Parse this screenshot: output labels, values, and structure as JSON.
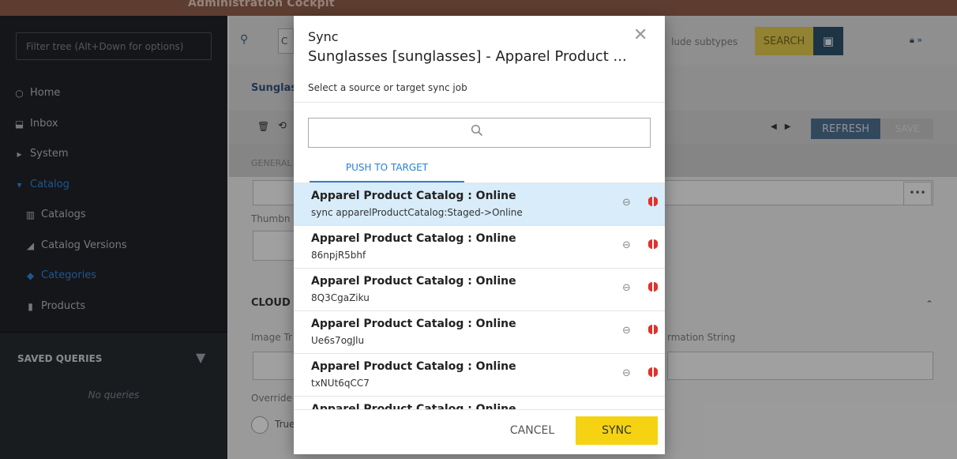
{
  "app": {
    "title": "Administration Cockpit"
  },
  "sidebar": {
    "filter_placeholder": "Filter tree (Alt+Down for options)",
    "items": [
      {
        "label": "Home",
        "icon": "home-icon"
      },
      {
        "label": "Inbox",
        "icon": "inbox-icon"
      },
      {
        "label": "System",
        "icon": "caret-right-icon"
      },
      {
        "label": "Catalog",
        "icon": "caret-down-icon"
      },
      {
        "label": "Catalogs",
        "icon": "catalogs-icon"
      },
      {
        "label": "Catalog Versions",
        "icon": "catalog-versions-icon"
      },
      {
        "label": "Categories",
        "icon": "tag-icon"
      },
      {
        "label": "Products",
        "icon": "product-icon"
      }
    ],
    "saved_queries": {
      "title": "SAVED QUERIES",
      "empty": "No queries"
    }
  },
  "toolbar": {
    "subtypes_label": "lude subtypes",
    "search_label": "SEARCH",
    "query_prefix": "C"
  },
  "editor": {
    "title": "Sunglas",
    "refresh_label": "REFRESH",
    "save_label": "SAVE",
    "general_tab": "GENERAL",
    "thumbnail_label": "Thumbn",
    "cloud_section": "CLOUD",
    "image_tr_label": "Image Tr",
    "transformation_label": "rmation String",
    "override_label": "Override",
    "true_label": "True"
  },
  "modal": {
    "title": "Sync",
    "subtitle": "Sunglasses [sunglasses] - Apparel Product ...",
    "description": "Select a source or target sync job",
    "tab_label": "PUSH TO TARGET",
    "rows": [
      {
        "title": "Apparel Product Catalog : Online",
        "detail": "sync apparelProductCatalog:Staged->Online"
      },
      {
        "title": "Apparel Product Catalog : Online",
        "detail": "86npjR5bhf"
      },
      {
        "title": "Apparel Product Catalog : Online",
        "detail": "8Q3CgaZiku"
      },
      {
        "title": "Apparel Product Catalog : Online",
        "detail": "Ue6s7ogJlu"
      },
      {
        "title": "Apparel Product Catalog : Online",
        "detail": "txNUt6qCC7"
      },
      {
        "title": "Apparel Product Catalog : Online",
        "detail": ""
      }
    ],
    "cancel_label": "CANCEL",
    "sync_label": "SYNC"
  },
  "colors": {
    "accent": "#2b7fd4",
    "sync_button": "#f5d312",
    "selected_row": "#d8ecfa",
    "status_red": "#e0322a"
  }
}
